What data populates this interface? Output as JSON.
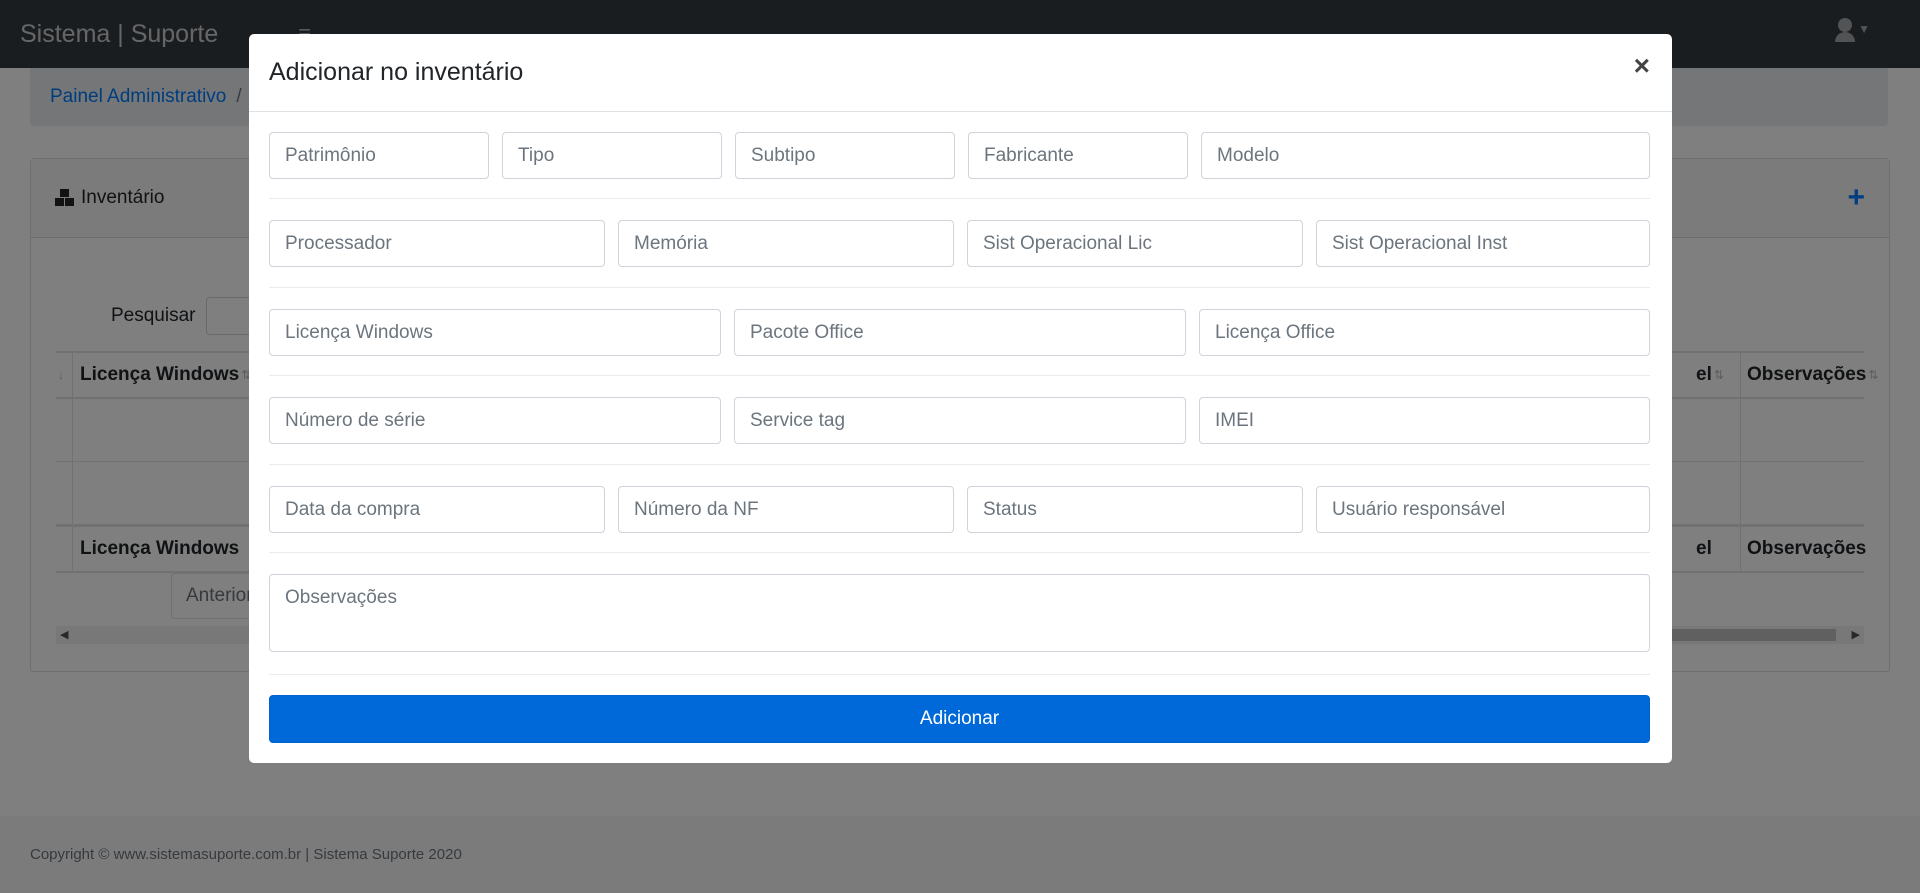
{
  "app": {
    "brand": "Sistema | Suporte",
    "menu_toggle_icon": "hamburger-icon",
    "user_icon": "user-icon",
    "caret_icon": "caret-down-icon"
  },
  "breadcrumb": {
    "home": "Painel Administrativo",
    "separator": "/"
  },
  "card": {
    "title": "Inventário",
    "title_icon": "boxes-icon",
    "add_icon": "plus-icon",
    "add_symbol": "+"
  },
  "search": {
    "label": "Pesquisar"
  },
  "table": {
    "left_sorter": "↓",
    "col_left": "Licença Windows",
    "col_mid_partial": "el",
    "col_right": "Observações",
    "sort_icon": "⇅"
  },
  "pager": {
    "previous": "Anterior"
  },
  "footer": {
    "copyright": "Copyright © www.sistemasuporte.com.br | Sistema Suporte 2020"
  },
  "modal": {
    "title": "Adicionar no inventário",
    "close_symbol": "×",
    "rows": [
      [
        "Patrimônio",
        "Tipo",
        "Subtipo",
        "Fabricante",
        "Modelo"
      ],
      [
        "Processador",
        "Memória",
        "Sist Operacional Lic",
        "Sist Operacional Inst"
      ],
      [
        "Licença Windows",
        "Pacote Office",
        "Licença Office"
      ],
      [
        "Número de série",
        "Service tag",
        "IMEI"
      ],
      [
        "Data da compra",
        "Número da NF",
        "Status",
        "Usuário responsável"
      ]
    ],
    "observations_placeholder": "Observações",
    "submit_label": "Adicionar"
  },
  "colors": {
    "navbar": "#343a40",
    "primary": "#0069d9",
    "link": "#007bff"
  }
}
